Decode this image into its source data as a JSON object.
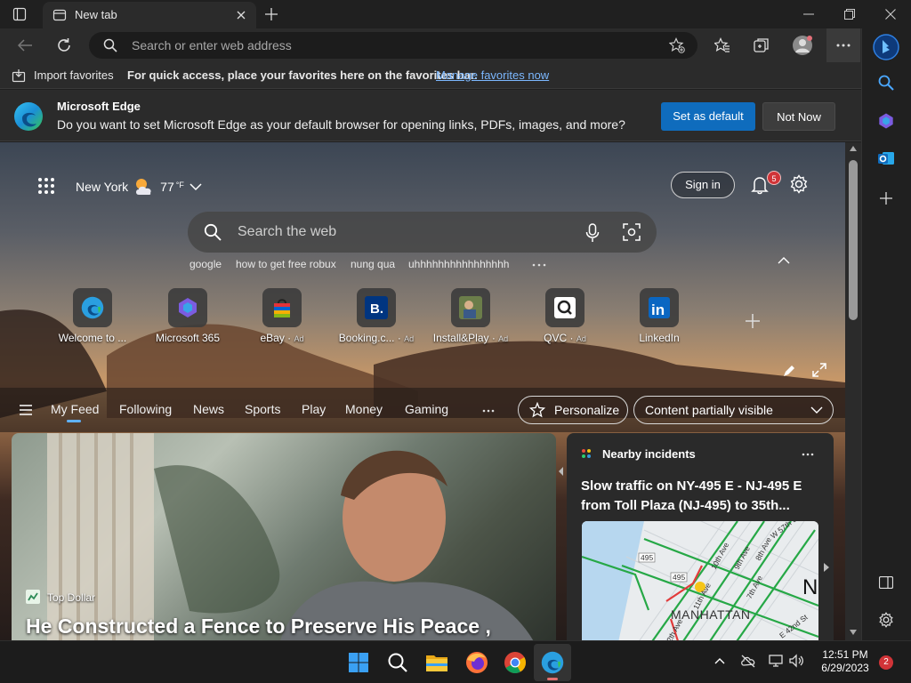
{
  "browser": {
    "tab": {
      "title": "New tab"
    },
    "address_bar": {
      "placeholder": "Search or enter web address"
    }
  },
  "favorites_bar": {
    "import_label": "Import favorites",
    "hint": "For quick access, place your favorites here on the favorites bar.",
    "manage_link": "Manage favorites now"
  },
  "infobar": {
    "title": "Microsoft Edge",
    "message": "Do you want to set Microsoft Edge as your default browser for opening links, PDFs, images, and more?",
    "primary_button": "Set as default",
    "secondary_button": "Not Now"
  },
  "newtab": {
    "location": "New York",
    "temperature": "77",
    "temp_unit": "°F",
    "signin_label": "Sign in",
    "notification_count": "5",
    "search_placeholder": "Search the web",
    "suggestions": [
      "google",
      "how to get free robux",
      "nung qua",
      "uhhhhhhhhhhhhhhhh"
    ],
    "quick_links": [
      {
        "label": "Welcome to ...",
        "ad": "",
        "icon": "edge-icon"
      },
      {
        "label": "Microsoft 365",
        "ad": "",
        "icon": "microsoft-365-icon"
      },
      {
        "label": "eBay",
        "ad": "Ad",
        "icon": "ebay-bag-icon"
      },
      {
        "label": "Booking.c...",
        "ad": "Ad",
        "icon": "booking-icon"
      },
      {
        "label": "Install&Play",
        "ad": "Ad",
        "icon": "install-play-icon"
      },
      {
        "label": "QVC",
        "ad": "Ad",
        "icon": "qvc-icon"
      },
      {
        "label": "LinkedIn",
        "ad": "",
        "icon": "linkedin-icon"
      }
    ]
  },
  "feed_nav": {
    "items": [
      "My Feed",
      "Following",
      "News",
      "Sports",
      "Play",
      "Money",
      "Gaming"
    ],
    "personalize_label": "Personalize",
    "content_visibility": "Content partially visible"
  },
  "hero_card": {
    "source": "Top Dollar",
    "headline": "He Constructed a Fence to Preserve His Peace ,"
  },
  "incidents_card": {
    "title": "Nearby incidents",
    "headline": "Slow traffic on NY-495 E - NJ-495 E from Toll Plaza (NJ-495) to 35th...",
    "map_labels": [
      "495",
      "495",
      "10th Ave",
      "9th Ave",
      "8th Ave",
      "W 57th St",
      "11th Ave",
      "12th Ave",
      "7th Ave",
      "MANHATTAN",
      "E 42nd St",
      "N"
    ]
  },
  "taskbar": {
    "time": "12:51 PM",
    "date": "6/29/2023",
    "notification_count": "2"
  }
}
